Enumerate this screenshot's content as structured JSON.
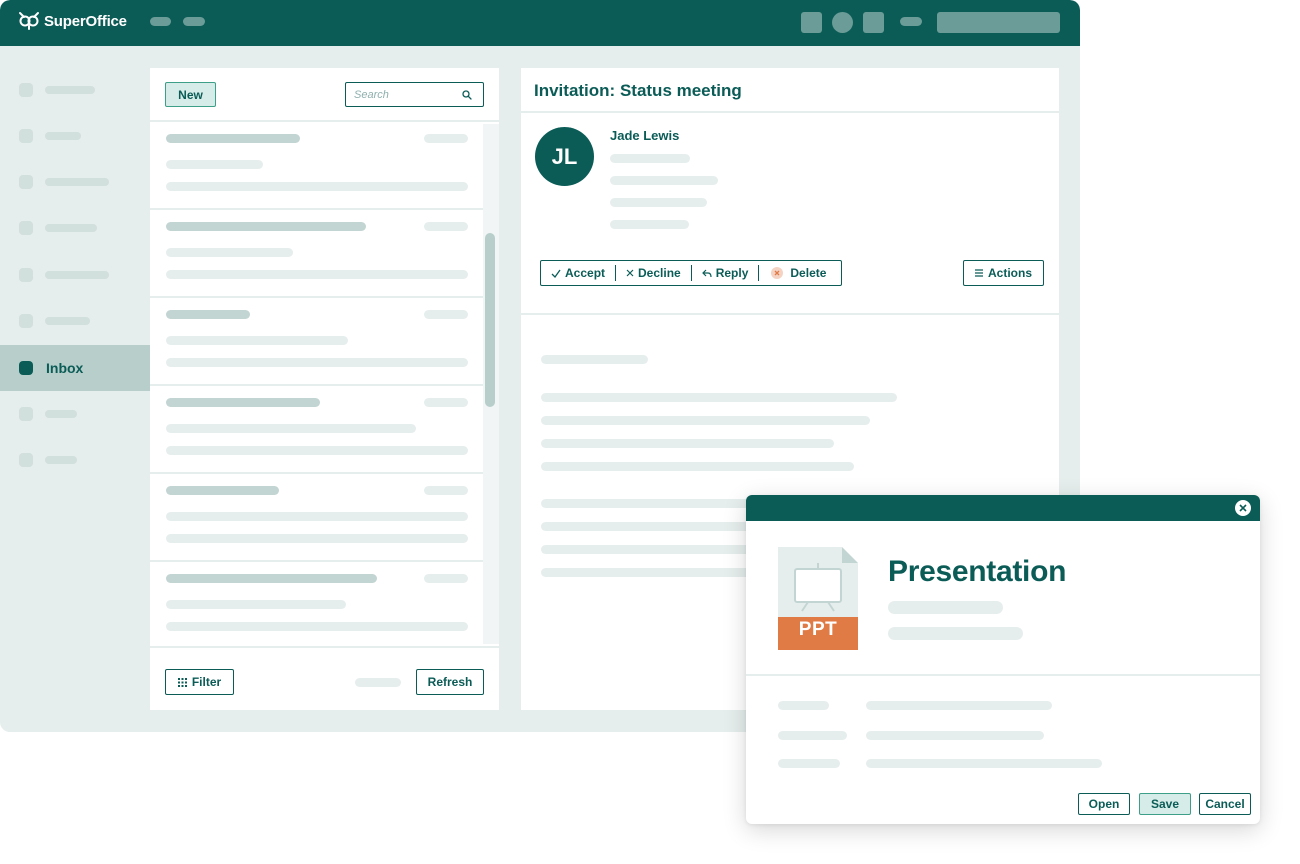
{
  "app": {
    "brand": "SuperOffice"
  },
  "sidebar": {
    "active_label": "Inbox"
  },
  "list": {
    "new_label": "New",
    "search_placeholder": "Search",
    "filter_label": "Filter",
    "refresh_label": "Refresh"
  },
  "detail": {
    "title": "Invitation: Status meeting",
    "avatar_initials": "JL",
    "sender_name": "Jade Lewis",
    "actions": {
      "accept": "Accept",
      "decline": "Decline",
      "reply": "Reply",
      "delete": "Delete",
      "menu": "Actions"
    }
  },
  "dialog": {
    "file_type": "PPT",
    "title": "Presentation",
    "open_label": "Open",
    "save_label": "Save",
    "cancel_label": "Cancel"
  },
  "colors": {
    "brand": "#0b5c57",
    "accent_light": "#d6ece8",
    "ppt": "#e07b45",
    "app_background": "#e6eeed"
  },
  "icons": {
    "logo": "owl-logo-icon",
    "search": "search-icon",
    "filter": "grid-icon",
    "accept": "check-icon",
    "decline": "x-icon",
    "reply": "reply-arrow-icon",
    "delete": "delete-circle-icon",
    "actions": "menu-icon",
    "close": "close-circle-icon",
    "file": "ppt-file-icon"
  }
}
